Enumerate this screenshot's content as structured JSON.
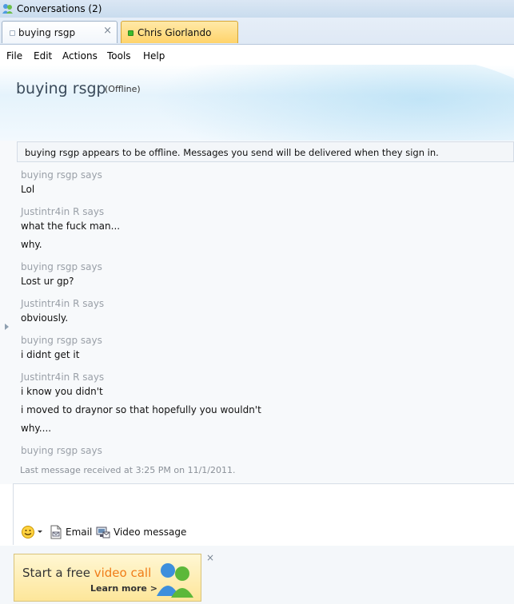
{
  "window": {
    "title": "Conversations (2)"
  },
  "tabs": [
    {
      "label": "buying rsgp",
      "close": "×"
    },
    {
      "label": "Chris Giorlando"
    }
  ],
  "menu": [
    "File",
    "Edit",
    "Actions",
    "Tools",
    "Help"
  ],
  "contact": {
    "name": "buying rsgp",
    "status": "(Offline)"
  },
  "notice": "buying rsgp appears to be offline. Messages you send will be delivered when they sign in.",
  "messages": [
    {
      "sender": "buying rsgp says",
      "lines": [
        "Lol"
      ]
    },
    {
      "sender": "Justintr4in R says",
      "lines": [
        "what the fuck man...",
        "why."
      ]
    },
    {
      "sender": "buying rsgp says",
      "lines": [
        "Lost ur gp?"
      ]
    },
    {
      "sender": "Justintr4in R says",
      "lines": [
        "obviously."
      ]
    },
    {
      "sender": "buying rsgp says",
      "lines": [
        "i didnt get it"
      ]
    },
    {
      "sender": "Justintr4in R says",
      "lines": [
        "i know you didn't",
        "i moved to draynor so that hopefully you wouldn't",
        "why...."
      ]
    },
    {
      "sender": "buying rsgp says",
      "lines": []
    }
  ],
  "last_message": "Last message received at 3:25 PM on 11/1/2011.",
  "toolbar": {
    "emoticon_icon": "smiley-icon",
    "email_label": "Email",
    "video_label": "Video message"
  },
  "ad": {
    "text_before": "Start a free ",
    "text_highlight": "video call",
    "learn_more": "Learn more >",
    "close": "×"
  },
  "colors": {
    "tab_active": "#ffd36a",
    "online": "#3dbb2b",
    "accent": "#f07c17"
  }
}
